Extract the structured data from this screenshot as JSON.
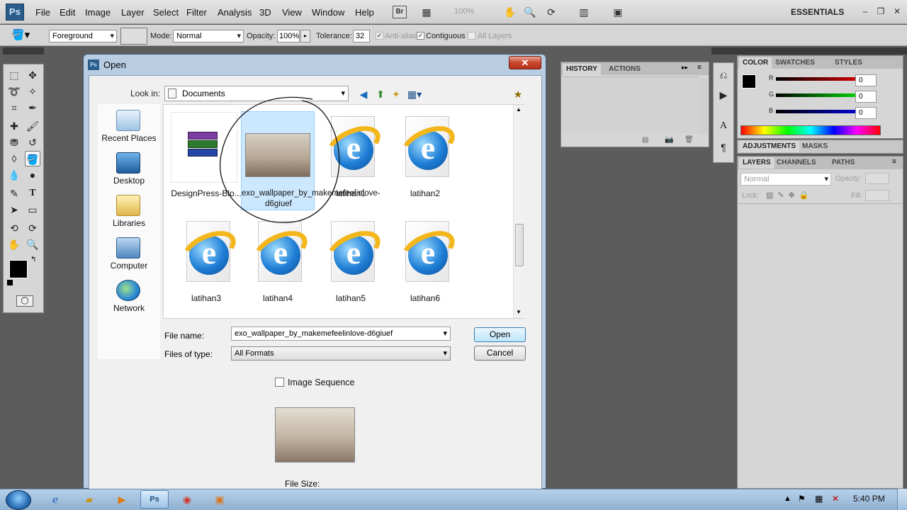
{
  "app": {
    "logo": "Ps",
    "menus": [
      "File",
      "Edit",
      "Image",
      "Layer",
      "Select",
      "Filter",
      "Analysis",
      "3D",
      "View",
      "Window",
      "Help"
    ],
    "bridge_label": "Br",
    "zoom": "100%",
    "workspace": "ESSENTIALS"
  },
  "options": {
    "fill_source": "Foreground",
    "mode_label": "Mode:",
    "mode_value": "Normal",
    "opacity_label": "Opacity:",
    "opacity_value": "100%",
    "tolerance_label": "Tolerance:",
    "tolerance_value": "32",
    "antialias_label": "Anti-alias",
    "contiguous_label": "Contiguous",
    "all_layers_label": "All Layers"
  },
  "dialog": {
    "title": "Open",
    "look_in_label": "Look in:",
    "look_in_value": "Documents",
    "places": [
      "Recent Places",
      "Desktop",
      "Libraries",
      "Computer",
      "Network"
    ],
    "files": [
      {
        "name": "DesignPress-Blo...",
        "kind": "winrar"
      },
      {
        "name": "exo_wallpaper_by_makemefeelinlove-d6giuef",
        "kind": "image",
        "selected": true
      },
      {
        "name": "latihan1",
        "kind": "ie"
      },
      {
        "name": "latihan2",
        "kind": "ie"
      },
      {
        "name": "latihan3",
        "kind": "ie"
      },
      {
        "name": "latihan4",
        "kind": "ie"
      },
      {
        "name": "latihan5",
        "kind": "ie"
      },
      {
        "name": "latihan6",
        "kind": "ie"
      }
    ],
    "file_name_label": "File name:",
    "file_name_value": "exo_wallpaper_by_makemefeelinlove-d6giuef",
    "files_of_type_label": "Files of type:",
    "files_of_type_value": "All Formats",
    "open_label": "Open",
    "cancel_label": "Cancel",
    "image_sequence_label": "Image Sequence",
    "file_size_label": "File Size:"
  },
  "panels": {
    "history_tab": "HISTORY",
    "actions_tab": "ACTIONS",
    "color_tab": "COLOR",
    "swatches_tab": "SWATCHES",
    "styles_tab": "STYLES",
    "r_label": "R",
    "r_value": "0",
    "g_label": "G",
    "g_value": "0",
    "b_label": "B",
    "b_value": "0",
    "adjustments_tab": "ADJUSTMENTS",
    "masks_tab": "MASKS",
    "layers_tab": "LAYERS",
    "channels_tab": "CHANNELS",
    "paths_tab": "PATHS",
    "blend_mode": "Normal",
    "opacity_label": "Opacity:",
    "lock_label": "Lock:",
    "fill_label": "Fill:"
  },
  "taskbar": {
    "clock": "5:40 PM",
    "active_app": "Ps"
  }
}
